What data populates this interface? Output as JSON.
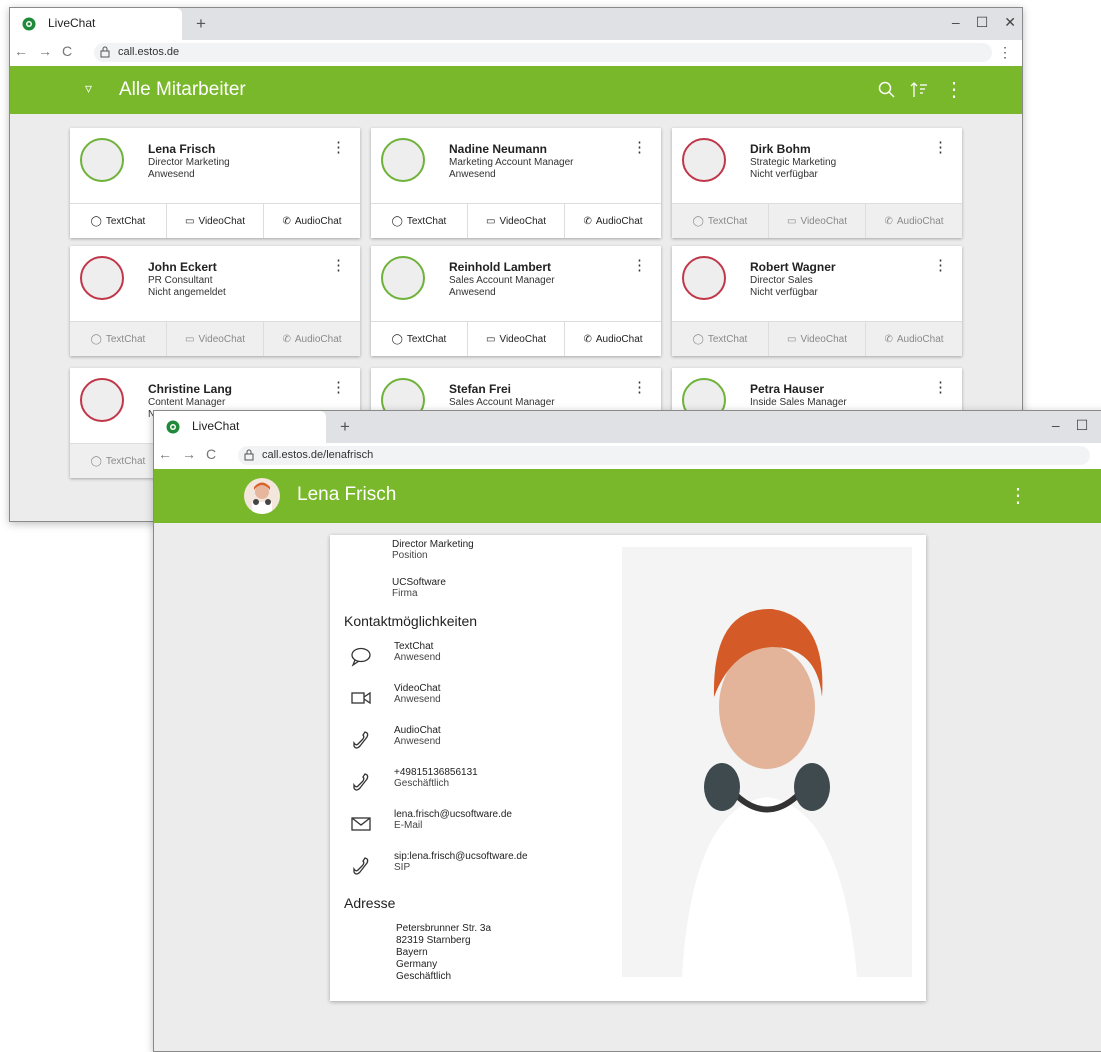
{
  "colors": {
    "accent_green": "#78b82a",
    "status_green": "#6fb23a",
    "status_red": "#c0374a"
  },
  "window1": {
    "tab_title": "LiveChat",
    "url": "call.estos.de",
    "header_title": "Alle Mitarbeiter",
    "contacts": [
      {
        "name": "Lena Frisch",
        "role": "Director Marketing",
        "status": "Anwesend",
        "available": true
      },
      {
        "name": "Nadine Neumann",
        "role": "Marketing Account Manager",
        "status": "Anwesend",
        "available": true
      },
      {
        "name": "Dirk Bohm",
        "role": "Strategic Marketing",
        "status": "Nicht verfügbar",
        "available": false
      },
      {
        "name": "John Eckert",
        "role": "PR Consultant",
        "status": "Nicht angemeldet",
        "available": false
      },
      {
        "name": "Reinhold Lambert",
        "role": "Sales Account Manager",
        "status": "Anwesend",
        "available": true
      },
      {
        "name": "Robert Wagner",
        "role": "Director Sales",
        "status": "Nicht verfügbar",
        "available": false
      },
      {
        "name": "Christine Lang",
        "role": "Content Manager",
        "status": "N",
        "available": false
      },
      {
        "name": "Stefan Frei",
        "role": "Sales Account Manager",
        "status": "",
        "available": true
      },
      {
        "name": "Petra Hauser",
        "role": "Inside Sales Manager",
        "status": "",
        "available": true
      }
    ],
    "actions": {
      "text": "TextChat",
      "video": "VideoChat",
      "audio": "AudioChat"
    }
  },
  "window2": {
    "tab_title": "LiveChat",
    "url": "call.estos.de/lenafrisch",
    "header_title": "Lena Frisch",
    "position_value": "Director Marketing",
    "position_label": "Position",
    "company_value": "UCSoftware",
    "company_label": "Firma",
    "contact_section": "Kontaktmöglichkeiten",
    "contacts": [
      {
        "icon": "chat-bubble-icon",
        "value": "TextChat",
        "label": "Anwesend"
      },
      {
        "icon": "video-camera-icon",
        "value": "VideoChat",
        "label": "Anwesend"
      },
      {
        "icon": "phone-icon",
        "value": "AudioChat",
        "label": "Anwesend"
      },
      {
        "icon": "phone-icon",
        "value": "+49815136856131",
        "label": "Geschäftlich"
      },
      {
        "icon": "envelope-icon",
        "value": "lena.frisch@ucsoftware.de",
        "label": "E-Mail"
      },
      {
        "icon": "phone-icon",
        "value": "sip:lena.frisch@ucsoftware.de",
        "label": "SIP"
      }
    ],
    "address_section": "Adresse",
    "address": {
      "street": "Petersbrunner Str. 3a",
      "city": "82319 Starnberg",
      "state": "Bayern",
      "country": "Germany",
      "type": "Geschäftlich"
    }
  }
}
